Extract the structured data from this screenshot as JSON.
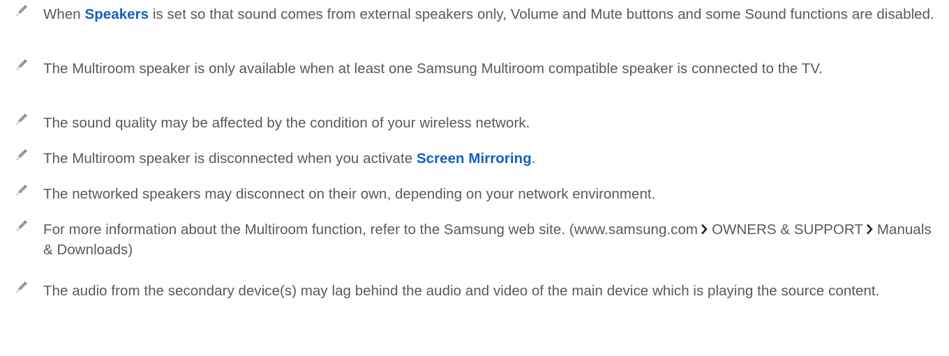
{
  "notes": [
    {
      "icon": "pencil-note-icon",
      "before": "When ",
      "highlight": "Speakers",
      "after": " is set so that sound comes from external speakers only, Volume and Mute buttons and some Sound functions are disabled."
    },
    {
      "icon": "pencil-note-icon",
      "text": "The Multiroom speaker is only available when at least one Samsung Multiroom compatible speaker is connected to the TV."
    },
    {
      "icon": "pencil-note-icon",
      "text": "The sound quality may be affected by the condition of your wireless network."
    },
    {
      "icon": "pencil-note-icon",
      "before": "The Multiroom speaker is disconnected when you activate ",
      "highlight": "Screen Mirroring",
      "after": "."
    },
    {
      "icon": "pencil-note-icon",
      "text": "The networked speakers may disconnect on their own, depending on your network environment."
    },
    {
      "icon": "pencil-note-icon",
      "part1": "For more information about the Multiroom function, refer to the Samsung web site. (www.samsung.com",
      "part2": "OWNERS & SUPPORT",
      "part3": "Manuals & Downloads)"
    },
    {
      "icon": "pencil-note-icon",
      "text": "The audio from the secondary device(s) may lag behind the audio and video of the main device which is playing the source content."
    }
  ],
  "colors": {
    "text": "#595959",
    "highlight": "#1560bd",
    "icon": "#7f7f7f"
  }
}
